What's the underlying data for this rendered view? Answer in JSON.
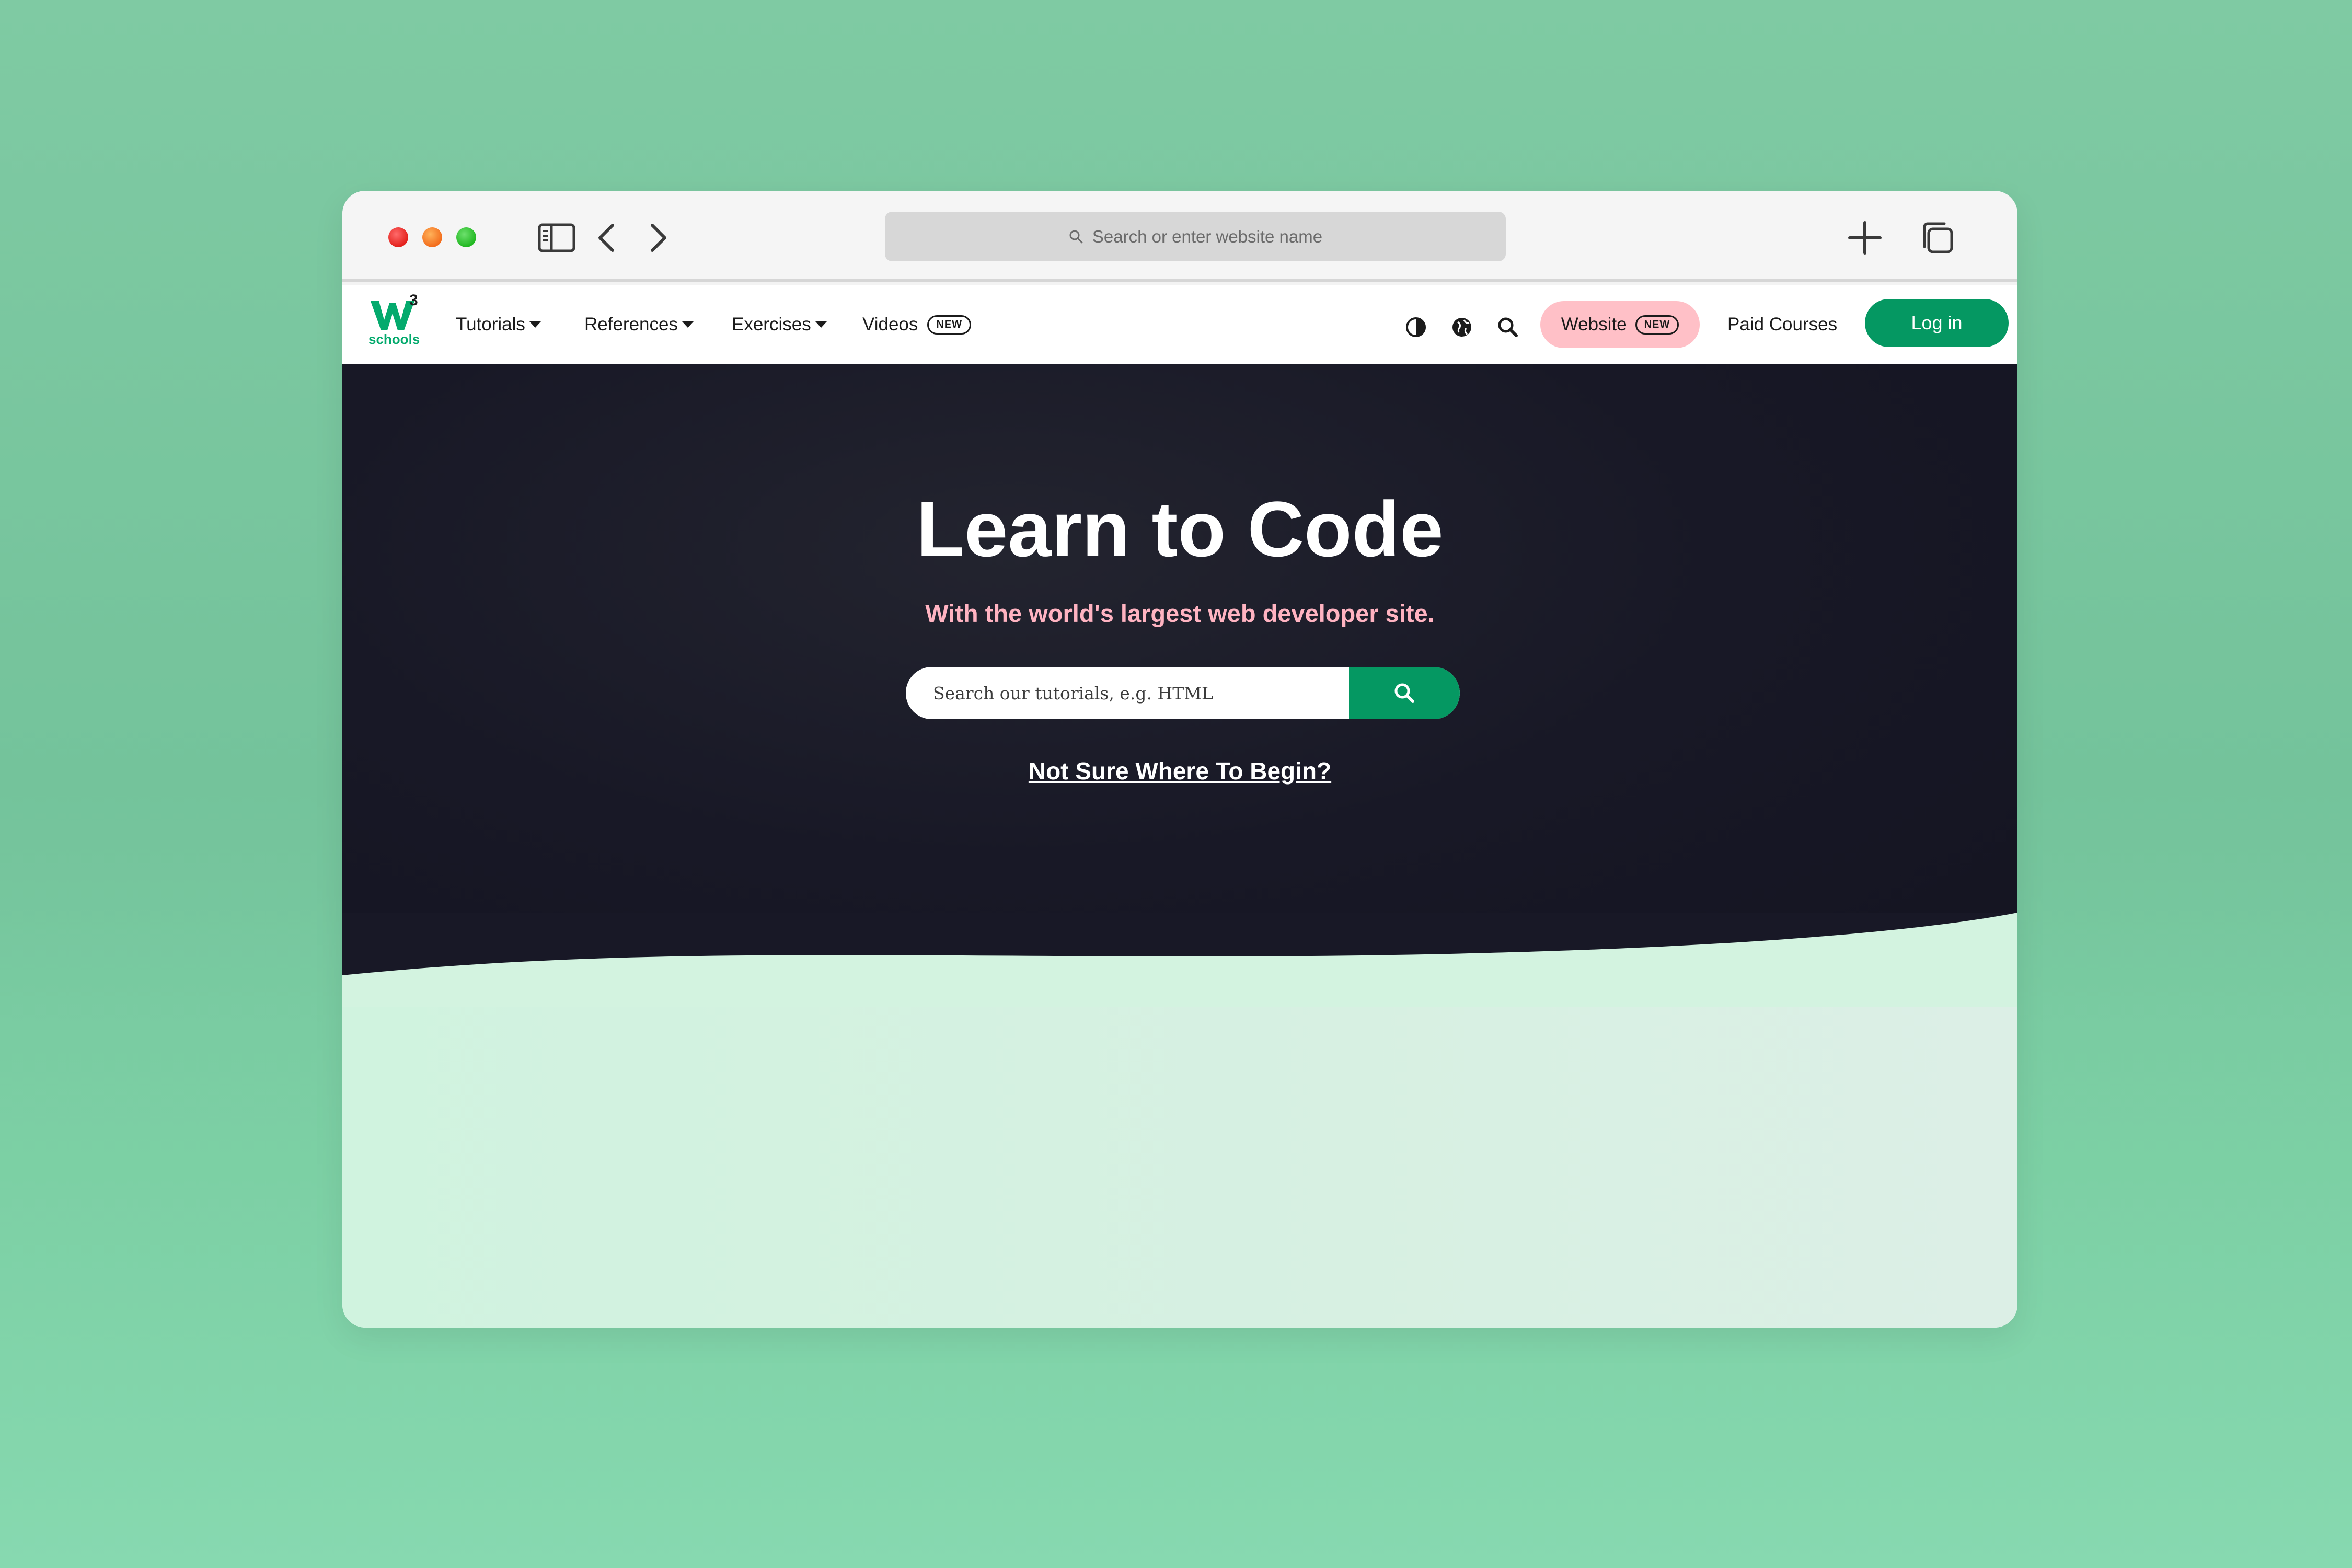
{
  "browser": {
    "address_placeholder": "Search or enter website name"
  },
  "nav": {
    "logo_text": "schools",
    "logo_sup": "3",
    "tutorials": "Tutorials",
    "references": "References",
    "exercises": "Exercises",
    "videos": "Videos",
    "new_badge": "NEW",
    "website": "Website",
    "paid_courses": "Paid Courses",
    "login": "Log in"
  },
  "hero": {
    "title": "Learn to Code",
    "subtitle": "With the world's largest web developer site.",
    "search_placeholder": "Search our tutorials, e.g. HTML",
    "begin_link": "Not Sure Where To Begin?"
  },
  "colors": {
    "brand_green": "#04aa6d",
    "pink": "#ffc0c7",
    "hero_dark": "#181826"
  }
}
